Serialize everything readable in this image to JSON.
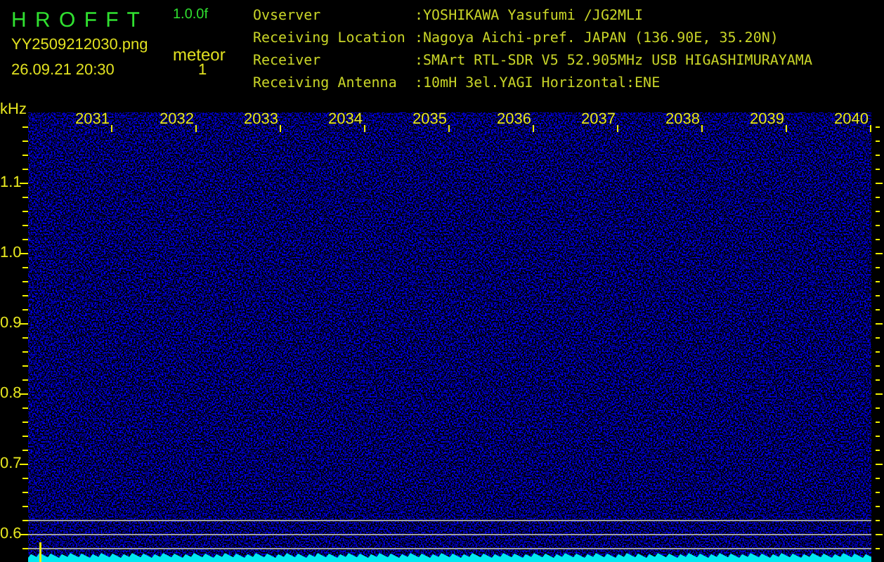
{
  "app": {
    "title": "H R O F F T",
    "version": "1.0.0f",
    "filename": "YY2509212030.png",
    "timestamp": "26.09.21 20:30",
    "event_label": "meteor",
    "event_count": "1"
  },
  "station": [
    {
      "label": "Ovserver",
      "value": ":YOSHIKAWA Yasufumi /JG2MLI"
    },
    {
      "label": "Receiving Location",
      "value": ":Nagoya Aichi-pref. JAPAN (136.90E, 35.20N)"
    },
    {
      "label": "Receiver",
      "value": ":SMArt RTL-SDR V5 52.905MHz USB HIGASHIMURAYAMA"
    },
    {
      "label": "Receiving Antenna",
      "value": ":10mH 3el.YAGI Horizontal:ENE"
    }
  ],
  "plot": {
    "unit": "kHz",
    "time_labels": [
      "2031",
      "2032",
      "2033",
      "2034",
      "2035",
      "2036",
      "2037",
      "2038",
      "2039",
      "2040"
    ],
    "frequency_labels": [
      "1.1",
      "1.0",
      "0.9",
      "0.8",
      "0.7",
      "0.6"
    ]
  }
}
